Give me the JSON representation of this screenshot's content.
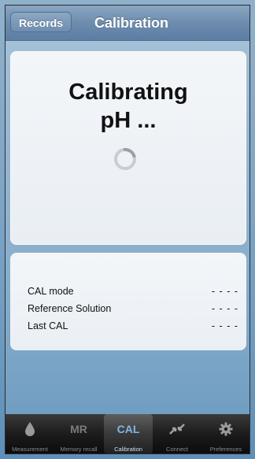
{
  "navbar": {
    "back_label": "Records",
    "title": "Calibration"
  },
  "status": {
    "line1": "Calibrating",
    "line2": "pH ..."
  },
  "info": {
    "rows": [
      {
        "label": "CAL mode",
        "value": "- - - -"
      },
      {
        "label": "Reference Solution",
        "value": "- - - -"
      },
      {
        "label": "Last CAL",
        "value": "- - - -"
      }
    ]
  },
  "tabbar": {
    "tabs": [
      {
        "icon": "drop-icon",
        "label": "Measurement"
      },
      {
        "icon_text": "MR",
        "label": "Memory recall"
      },
      {
        "icon_text": "CAL",
        "label": "Calibration",
        "active": true
      },
      {
        "icon": "connect-arrows-icon",
        "label": "Connect"
      },
      {
        "icon": "gear-icon",
        "label": "Preferences"
      }
    ]
  },
  "colors": {
    "active_tab": "#7fb7ea",
    "nav": "#6d8cae"
  }
}
